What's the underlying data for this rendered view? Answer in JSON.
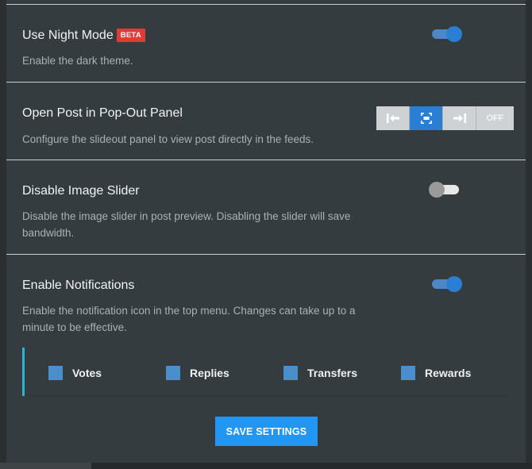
{
  "settings": {
    "night_mode": {
      "title": "Use Night Mode",
      "badge": "BETA",
      "description": "Enable the dark theme.",
      "enabled": true
    },
    "popout_panel": {
      "title": "Open Post in Pop-Out Panel",
      "description": "Configure the slideout panel to view post directly in the feeds.",
      "options": [
        {
          "icon": "panel-left-icon",
          "label": ""
        },
        {
          "icon": "panel-center-icon",
          "label": ""
        },
        {
          "icon": "panel-right-icon",
          "label": ""
        },
        {
          "icon": "",
          "label": "OFF"
        }
      ],
      "selected_index": 1
    },
    "image_slider": {
      "title": "Disable Image Slider",
      "description": "Disable the image slider in post preview. Disabling the slider will save bandwidth.",
      "enabled": false
    },
    "notifications": {
      "title": "Enable Notifications",
      "description": "Enable the notification icon in the top menu. Changes can take up to a minute to be effective.",
      "enabled": true,
      "types": [
        {
          "label": "Votes"
        },
        {
          "label": "Replies"
        },
        {
          "label": "Transfers"
        },
        {
          "label": "Rewards"
        }
      ]
    }
  },
  "save_label": "SAVE SETTINGS",
  "colors": {
    "accent": "#2a7fd4",
    "button": "#2196f3",
    "beta": "#e53935",
    "indicator": "#25b7d3"
  }
}
